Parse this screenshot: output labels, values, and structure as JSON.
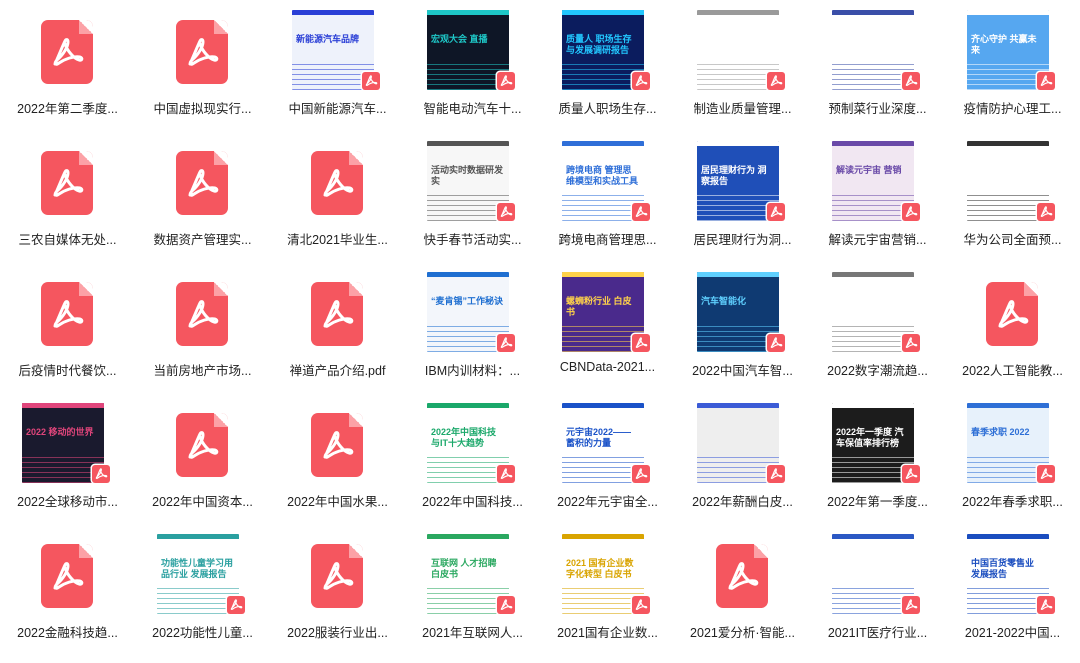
{
  "files": [
    {
      "name": "2022年第二季度...",
      "kind": "icon"
    },
    {
      "name": "中国虚拟现实行...",
      "kind": "icon"
    },
    {
      "name": "中国新能源汽车...",
      "kind": "thumb",
      "icon": "car-photo-thumbnail",
      "bg": "#eef2fb",
      "accent": "#2a3fd6",
      "text": "新能源汽车品牌"
    },
    {
      "name": "智能电动汽车十...",
      "kind": "thumb",
      "icon": "conference-live-thumbnail",
      "bg": "#0e1626",
      "accent": "#1ec7c7",
      "text": "宏观大会 直播"
    },
    {
      "name": "质量人职场生存...",
      "kind": "thumb",
      "icon": "career-report-thumbnail",
      "bg": "#0b1c5e",
      "accent": "#22c7ff",
      "text": "质量人 职场生存与发展调研报告"
    },
    {
      "name": "制造业质量管理...",
      "kind": "thumb",
      "icon": "document-page-thumbnail",
      "bg": "#ffffff",
      "accent": "#9a9a9a",
      "text": ""
    },
    {
      "name": "预制菜行业深度...",
      "kind": "thumb",
      "icon": "document-page-thumbnail",
      "bg": "#ffffff",
      "accent": "#3a4ea8",
      "text": ""
    },
    {
      "name": "疫情防护心理工...",
      "kind": "thumb",
      "icon": "banner-thumbnail",
      "bg": "#56a7f0",
      "accent": "#ffffff",
      "text": "齐心守护 共赢未来"
    },
    {
      "name": "三农自媒体无处...",
      "kind": "icon"
    },
    {
      "name": "数据资产管理实...",
      "kind": "icon"
    },
    {
      "name": "清北2021毕业生...",
      "kind": "icon"
    },
    {
      "name": "快手春节活动实...",
      "kind": "thumb",
      "icon": "slide-thumbnail",
      "bg": "#f7f7f7",
      "accent": "#555555",
      "text": "活动实时数据研发实"
    },
    {
      "name": "跨境电商管理思...",
      "kind": "thumb",
      "icon": "ecommerce-report-thumbnail",
      "bg": "#ffffff",
      "accent": "#2f6fd8",
      "text": "跨境电商 管理思维模型和实战工具"
    },
    {
      "name": "居民理财行为洞...",
      "kind": "thumb",
      "icon": "finance-report-thumbnail",
      "bg": "#1f4fb8",
      "accent": "#ffffff",
      "text": "居民理财行为 洞察报告"
    },
    {
      "name": "解读元宇宙营销...",
      "kind": "thumb",
      "icon": "metaverse-thumbnail",
      "bg": "#f1e7f2",
      "accent": "#6a4aa8",
      "text": "解读元宇宙 营销"
    },
    {
      "name": "华为公司全面预...",
      "kind": "thumb",
      "icon": "document-page-thumbnail",
      "bg": "#ffffff",
      "accent": "#333333",
      "text": ""
    },
    {
      "name": "后疫情时代餐饮...",
      "kind": "icon"
    },
    {
      "name": "当前房地产市场...",
      "kind": "icon"
    },
    {
      "name": "禅道产品介绍.pdf",
      "kind": "icon"
    },
    {
      "name": "IBM内训材料：...",
      "kind": "thumb",
      "icon": "training-slide-thumbnail",
      "bg": "#f3f6fb",
      "accent": "#1f6fd1",
      "text": "“麦肯锡”工作秘诀"
    },
    {
      "name": "CBNData-2021...",
      "kind": "thumb",
      "icon": "food-report-thumbnail",
      "bg": "#4a2a8c",
      "accent": "#ffd24a",
      "text": "螺蛳粉行业 白皮书"
    },
    {
      "name": "2022中国汽车智...",
      "kind": "thumb",
      "icon": "auto-report-thumbnail",
      "bg": "#0f3a72",
      "accent": "#5fd0ff",
      "text": "汽车智能化"
    },
    {
      "name": "2022数字潮流趋...",
      "kind": "thumb",
      "icon": "document-page-thumbnail",
      "bg": "#ffffff",
      "accent": "#777777",
      "text": ""
    },
    {
      "name": "2022人工智能教...",
      "kind": "icon"
    },
    {
      "name": "2022全球移动市...",
      "kind": "thumb",
      "icon": "mobile-market-thumbnail",
      "bg": "#1a1a2e",
      "accent": "#e0457b",
      "text": "2022 移动的世界"
    },
    {
      "name": "2022年中国资本...",
      "kind": "icon"
    },
    {
      "name": "2022年中国水果...",
      "kind": "icon"
    },
    {
      "name": "2022年中国科技...",
      "kind": "thumb",
      "icon": "tech-report-thumbnail",
      "bg": "#ffffff",
      "accent": "#1aa86a",
      "text": "2022年中国科技与IT十大趋势"
    },
    {
      "name": "2022年元宇宙全...",
      "kind": "thumb",
      "icon": "metaverse-report-thumbnail",
      "bg": "#ffffff",
      "accent": "#1a52c8",
      "text": "元宇宙2022——蓄积的力量"
    },
    {
      "name": "2022年薪酬白皮...",
      "kind": "thumb",
      "icon": "salary-report-thumbnail",
      "bg": "#eeeeee",
      "accent": "#3b5bd6",
      "text": ""
    },
    {
      "name": "2022年第一季度...",
      "kind": "thumb",
      "icon": "auto-value-thumbnail",
      "bg": "#1c1c1c",
      "accent": "#ffffff",
      "text": "2022年一季度 汽车保值率排行榜"
    },
    {
      "name": "2022年春季求职...",
      "kind": "thumb",
      "icon": "jobs-report-thumbnail",
      "bg": "#e7f1fb",
      "accent": "#2e6fd6",
      "text": "春季求职 2022"
    },
    {
      "name": "2022金融科技趋...",
      "kind": "icon"
    },
    {
      "name": "2022功能性儿童...",
      "kind": "thumb",
      "icon": "children-report-thumbnail",
      "bg": "#ffffff",
      "accent": "#2aa0a0",
      "text": "功能性儿童学习用品行业 发展报告"
    },
    {
      "name": "2022服装行业出...",
      "kind": "icon"
    },
    {
      "name": "2021年互联网人...",
      "kind": "thumb",
      "icon": "internet-talent-thumbnail",
      "bg": "#ffffff",
      "accent": "#2aa860",
      "text": "互联网 人才招聘白皮书"
    },
    {
      "name": "2021国有企业数...",
      "kind": "thumb",
      "icon": "soe-report-thumbnail",
      "bg": "#ffffff",
      "accent": "#d9a400",
      "text": "2021 国有企业数字化转型 白皮书"
    },
    {
      "name": "2021爱分析·智能...",
      "kind": "icon"
    },
    {
      "name": "2021IT医疗行业...",
      "kind": "thumb",
      "icon": "document-page-thumbnail",
      "bg": "#ffffff",
      "accent": "#2b58c4",
      "text": ""
    },
    {
      "name": "2021-2022中国...",
      "kind": "thumb",
      "icon": "retail-report-thumbnail",
      "bg": "#ffffff",
      "accent": "#1a4dbf",
      "text": "中国百货零售业 发展报告"
    }
  ]
}
